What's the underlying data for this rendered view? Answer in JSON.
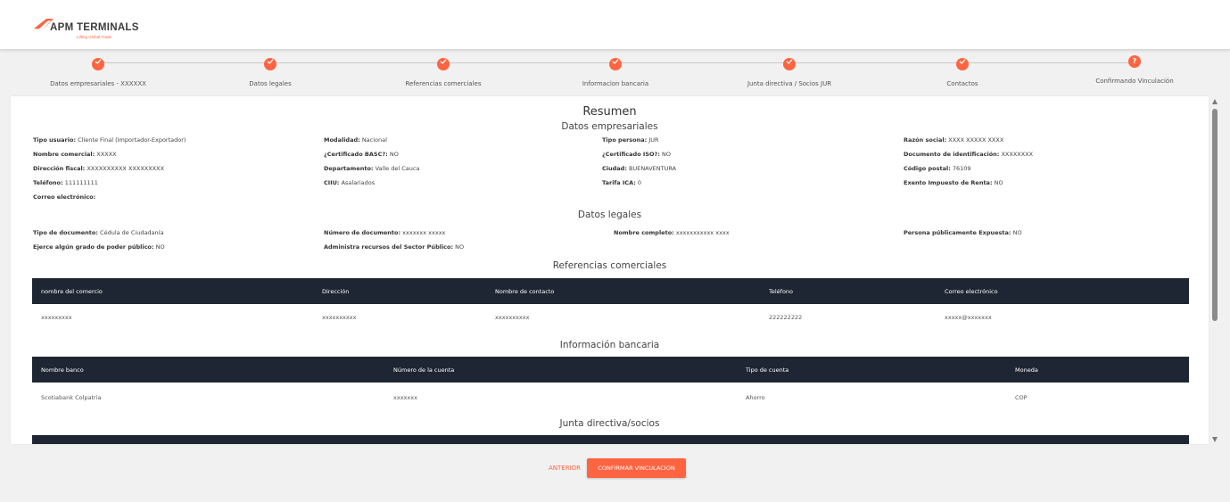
{
  "brand": {
    "name": "APM TERMINALS",
    "tagline": "Lifting Global Trade",
    "color": "#ff6441"
  },
  "steps": [
    {
      "label": "Datos empresariales - XXXXXX",
      "state": "done"
    },
    {
      "label": "Datos legales",
      "state": "done"
    },
    {
      "label": "Referencias comerciales",
      "state": "done"
    },
    {
      "label": "Informacion bancaria",
      "state": "done"
    },
    {
      "label": "Junta directiva / Socios JUR",
      "state": "done"
    },
    {
      "label": "Contactos",
      "state": "done"
    },
    {
      "label": "Confirmando Vinculación",
      "state": "current",
      "marker": "?"
    }
  ],
  "summary": {
    "title": "Resumen",
    "empresariales": {
      "title": "Datos empresariales",
      "fields": [
        {
          "label": "Tipo usuario:",
          "value": "Cliente Final (Importador-Exportador)"
        },
        {
          "label": "Modalidad:",
          "value": "Nacional"
        },
        {
          "label": "Tipo persona:",
          "value": "JUR"
        },
        {
          "label": "Razón social:",
          "value": "XXXX XXXXX XXXX"
        },
        {
          "label": "Nombre comercial:",
          "value": "XXXXX"
        },
        {
          "label": "¿Certificado BASC?:",
          "value": "NO"
        },
        {
          "label": "¿Certificado ISO?:",
          "value": "NO"
        },
        {
          "label": "Documento de identificación:",
          "value": "XXXXXXXX"
        },
        {
          "label": "Dirección fiscal:",
          "value": "XXXXXXXXXX XXXXXXXXX"
        },
        {
          "label": "Departamento:",
          "value": "Valle del Cauca"
        },
        {
          "label": "Ciudad:",
          "value": "BUENAVENTURA"
        },
        {
          "label": "Código postal:",
          "value": "76109"
        },
        {
          "label": "Teléfono:",
          "value": "111111111"
        },
        {
          "label": "CIIU:",
          "value": "Asalariados"
        },
        {
          "label": "Tarifa ICA:",
          "value": "0"
        },
        {
          "label": "Exento Impuesto de Renta:",
          "value": "NO"
        },
        {
          "label": "Correo electrónico:",
          "value": ""
        }
      ]
    },
    "legales": {
      "title": "Datos legales",
      "fields": [
        {
          "label": "Tipo de documento:",
          "value": "Cédula de Ciudadanía"
        },
        {
          "label": "Número de documento:",
          "value": "xxxxxxx xxxxx"
        },
        {
          "label": "Nombre completo:",
          "value": "xxxxxxxxxxx xxxx"
        },
        {
          "label": "Persona públicamente Expuesta:",
          "value": "NO"
        },
        {
          "label": "Ejerce algún grado de poder público:",
          "value": "NO"
        },
        {
          "label": "Administra recursos del Sector Público:",
          "value": "NO"
        }
      ]
    },
    "referencias": {
      "title": "Referencias comerciales",
      "headers": [
        "nombre del comercio",
        "Dirección",
        "Nombre de contacto",
        "Teléfono",
        "Correo electrónico"
      ],
      "rows": [
        [
          "xxxxxxxxx",
          "xxxxxxxxxx",
          "xxxxxxxxxx",
          "222222222",
          "xxxxx@xxxxxxx"
        ]
      ]
    },
    "bancaria": {
      "title": "Información bancaria",
      "headers": [
        "Nombre banco",
        "Número de la cuenta",
        "Tipo de cuenta",
        "Moneda"
      ],
      "rows": [
        [
          "Scotiabank Colpatria",
          "xxxxxxx",
          "Ahorro",
          "COP"
        ]
      ]
    },
    "junta": {
      "title": "Junta directiva/socios"
    }
  },
  "actions": {
    "prev_label": "ANTERIOR",
    "confirm_label": "CONFIRMAR VINCULACION"
  }
}
